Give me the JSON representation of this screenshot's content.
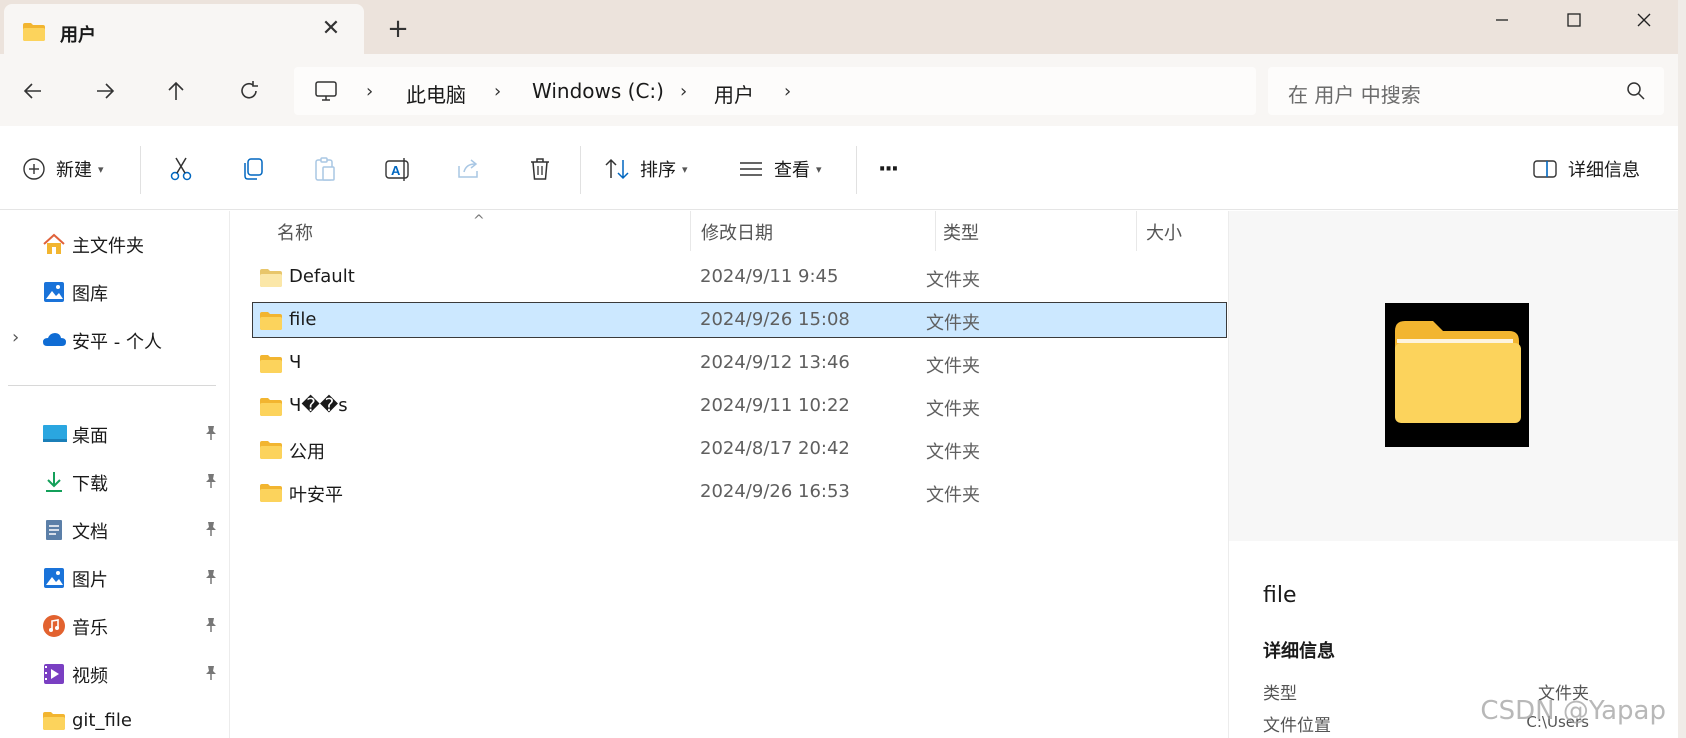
{
  "tab": {
    "title": "用户",
    "close_glyph": "✕",
    "new_tab_glyph": "+"
  },
  "window_controls": {
    "minimize": "—",
    "maximize": "☐",
    "close": "✕"
  },
  "address": {
    "crumbs": [
      "此电脑",
      "Windows (C:)",
      "用户"
    ],
    "separator": "›"
  },
  "search": {
    "placeholder": "在 用户 中搜索"
  },
  "commandbar": {
    "new_label": "新建",
    "sort_label": "排序",
    "view_label": "查看",
    "more_label": "···",
    "details_label": "详细信息"
  },
  "sidebar": {
    "items": [
      {
        "label": "主文件夹",
        "icon": "home-icon"
      },
      {
        "label": "图库",
        "icon": "gallery-icon"
      },
      {
        "label": "安平 - 个人",
        "icon": "onedrive-icon"
      },
      {
        "label": "桌面",
        "icon": "desktop-icon"
      },
      {
        "label": "下载",
        "icon": "download-icon"
      },
      {
        "label": "文档",
        "icon": "documents-icon"
      },
      {
        "label": "图片",
        "icon": "pictures-icon"
      },
      {
        "label": "音乐",
        "icon": "music-icon"
      },
      {
        "label": "视频",
        "icon": "video-icon"
      },
      {
        "label": "git_file",
        "icon": "folder-icon"
      }
    ],
    "expand_glyph": "›",
    "pin_glyph": "📌"
  },
  "list": {
    "columns": [
      "名称",
      "修改日期",
      "类型",
      "大小"
    ],
    "sort_glyph": "^",
    "rows": [
      {
        "name": "Default",
        "date": "2024/9/11 9:45",
        "type": "文件夹",
        "selected": false
      },
      {
        "name": "file",
        "date": "2024/9/26 15:08",
        "type": "文件夹",
        "selected": true
      },
      {
        "name": "Ч",
        "date": "2024/9/12 13:46",
        "type": "文件夹",
        "selected": false
      },
      {
        "name": "Ч��s",
        "date": "2024/9/11 10:22",
        "type": "文件夹",
        "selected": false
      },
      {
        "name": "公用",
        "date": "2024/8/17 20:42",
        "type": "文件夹",
        "selected": false
      },
      {
        "name": "叶安平",
        "date": "2024/9/26 16:53",
        "type": "文件夹",
        "selected": false
      }
    ]
  },
  "details": {
    "name": "file",
    "heading": "详细信息",
    "type_label": "类型",
    "type_value": "文件夹",
    "location_label": "文件位置",
    "location_value": "C:\\Users"
  },
  "watermark": "CSDN @Yapap",
  "colors": {
    "selection": "#cce8ff",
    "accent": "#0067c0",
    "folder": "#f9c940"
  }
}
